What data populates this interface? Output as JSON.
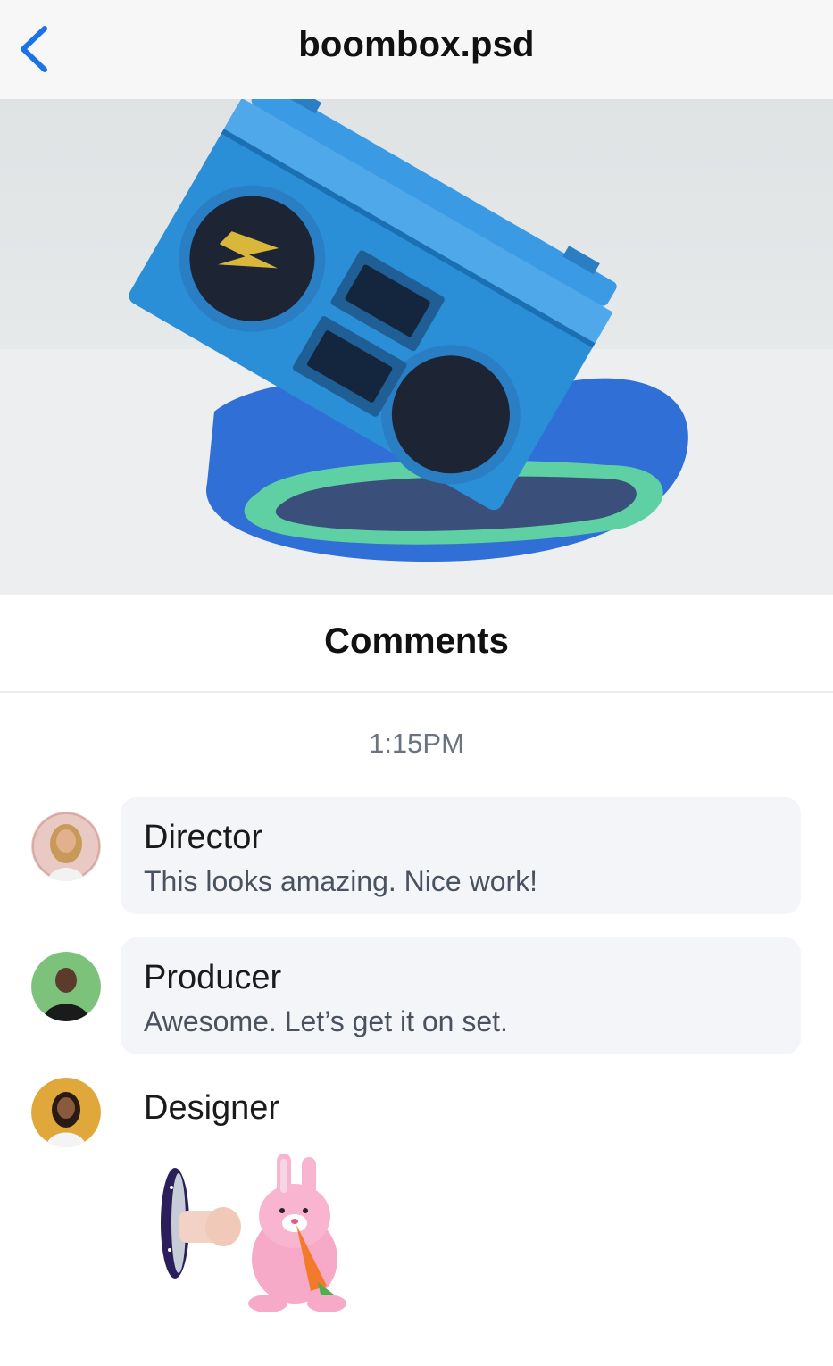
{
  "nav": {
    "title": "boombox.psd",
    "back_icon": "chevron-left-icon",
    "accent": "#1a73e8"
  },
  "hero": {
    "image": "boombox-photo"
  },
  "comments": {
    "header": "Comments",
    "timestamp": "1:15PM",
    "items": [
      {
        "author": "Director",
        "message": "This looks amazing. Nice work!",
        "avatar_bg": "#e9c9c3"
      },
      {
        "author": "Producer",
        "message": "Awesome. Let’s get it on set.",
        "avatar_bg": "#7cc27a"
      },
      {
        "author": "Designer",
        "message": "",
        "avatar_bg": "#e0a83a",
        "sticker": "bunny-portal-sticker"
      }
    ]
  }
}
